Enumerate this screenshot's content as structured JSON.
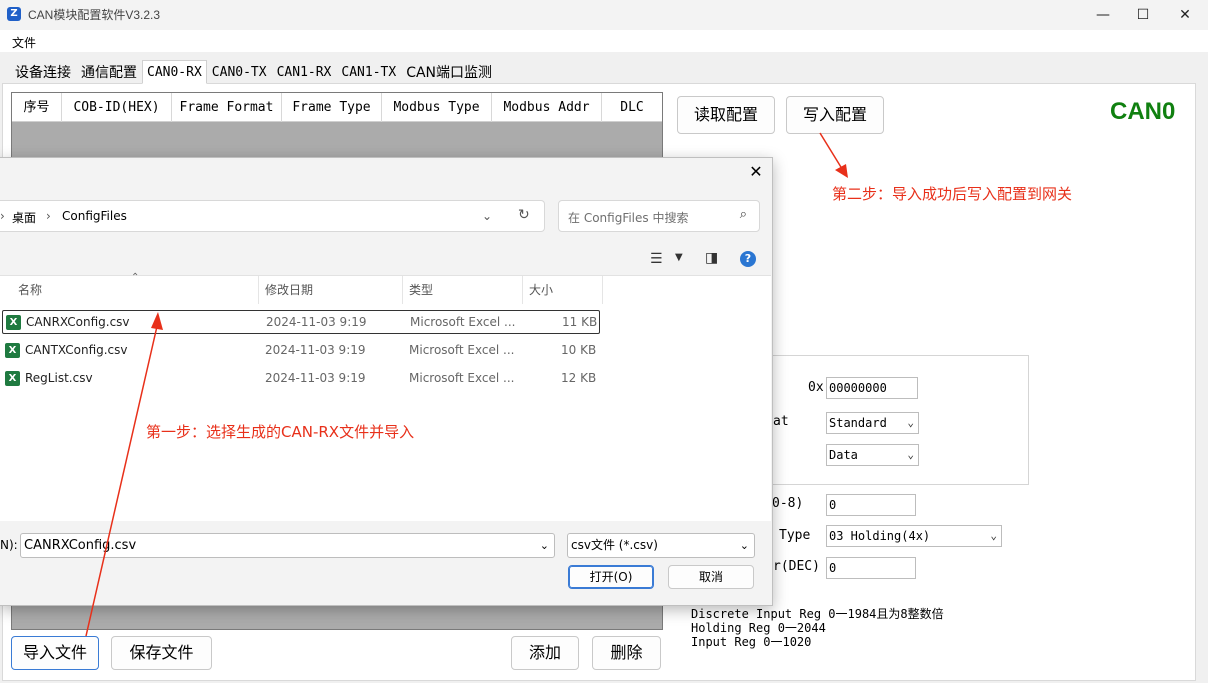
{
  "window": {
    "title": "CAN模块配置软件V3.2.3",
    "controls": [
      "—",
      "☐",
      "✕"
    ]
  },
  "menu": {
    "file": "文件"
  },
  "tabs": [
    "设备连接",
    "通信配置",
    "CAN0-RX",
    "CAN0-TX",
    "CAN1-RX",
    "CAN1-TX",
    "CAN端口监测"
  ],
  "grid": {
    "columns": [
      "序号",
      "COB-ID(HEX)",
      "Frame Format",
      "Frame Type",
      "Modbus Type",
      "Modbus Addr",
      "DLC"
    ]
  },
  "buttons": {
    "read_config": "读取配置",
    "write_config": "写入配置",
    "import_file": "导入文件",
    "save_file": "保存文件",
    "add": "添加",
    "delete": "删除"
  },
  "channel_label": "CAN0",
  "annotations": {
    "step1": "第一步：选择生成的CAN-RX文件并导入",
    "step2": "第二步：导入成功后写入配置到网关"
  },
  "form": {
    "cobid_prefix_partial": ")",
    "cobid_hex_prefix": "0x",
    "cobid_value": "00000000",
    "frame_format_label_partial": "at",
    "frame_format_value": "Standard",
    "frame_type_value": "Data",
    "dlc_label_partial": "0-8)",
    "dlc_value": "0",
    "modbus_type_label_partial": "Type",
    "modbus_type_value": "03 Holding(4x)",
    "modbus_addr_label_partial": "r(DEC)",
    "modbus_addr_value": "0",
    "info_lines": "Discrete Input Reg 0一1984且为8整数倍\nHolding Reg 0一2044\nInput Reg 0一1020"
  },
  "dialog": {
    "close": "✕",
    "breadcrumb": [
      "桌面",
      "ConfigFiles"
    ],
    "search_placeholder": "在 ConfigFiles 中搜索",
    "columns": [
      "名称",
      "修改日期",
      "类型",
      "大小"
    ],
    "files": [
      {
        "name": "CANRXConfig.csv",
        "date": "2024-11-03 9:19",
        "type": "Microsoft Excel ...",
        "size": "11 KB"
      },
      {
        "name": "CANTXConfig.csv",
        "date": "2024-11-03 9:19",
        "type": "Microsoft Excel ...",
        "size": "10 KB"
      },
      {
        "name": "RegList.csv",
        "date": "2024-11-03 9:19",
        "type": "Microsoft Excel ...",
        "size": "12 KB"
      }
    ],
    "filename_label_partial": "N):",
    "filename_value": "CANRXConfig.csv",
    "filetype_value": "csv文件 (*.csv)",
    "open_button": "打开(O)",
    "cancel_button": "取消"
  },
  "colors": {
    "accent": "#108010",
    "annotation": "#e8301a",
    "primary_border": "#3a7bd5"
  }
}
